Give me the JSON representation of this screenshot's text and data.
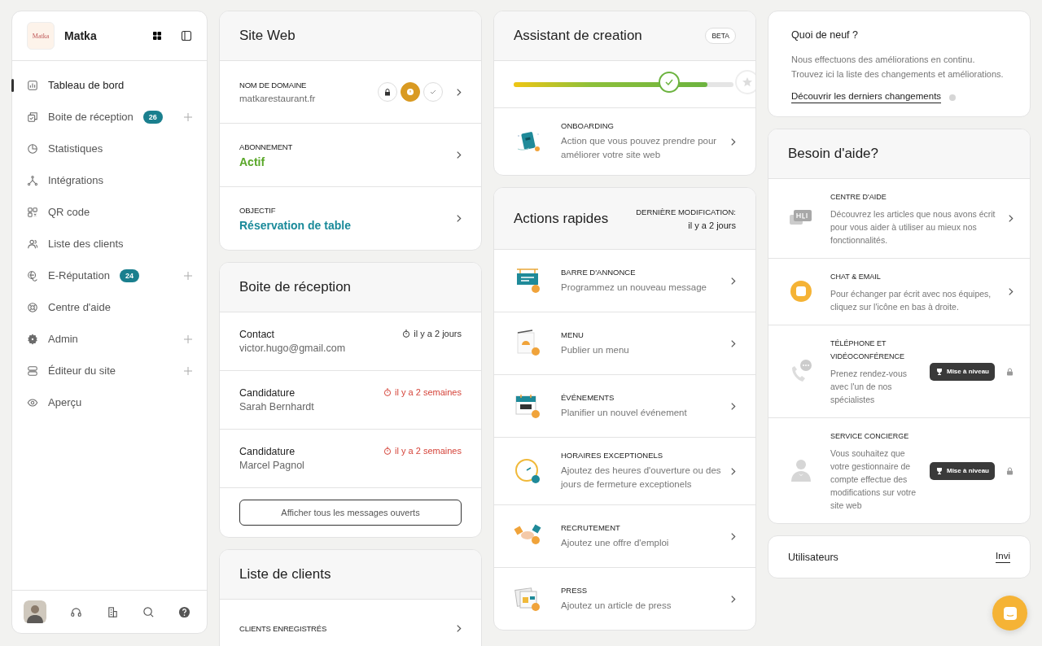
{
  "sidebar": {
    "brand": {
      "logo_text": "Matka",
      "name": "Matka"
    },
    "items": [
      {
        "kind": "dashboard",
        "label": "Tableau de bord",
        "selected": true,
        "expandable": false
      },
      {
        "kind": "inbox",
        "label": "Boite de réception",
        "badge": "26",
        "selected": false,
        "expandable": true
      },
      {
        "kind": "stats",
        "label": "Statistiques",
        "selected": false,
        "expandable": false
      },
      {
        "kind": "integrations",
        "label": "Intégrations",
        "selected": false,
        "expandable": false
      },
      {
        "kind": "qr",
        "label": "QR code",
        "selected": false,
        "expandable": false
      },
      {
        "kind": "clients",
        "label": "Liste des clients",
        "selected": false,
        "expandable": false
      },
      {
        "kind": "reputation",
        "label": "E-Réputation",
        "badge": "24",
        "selected": false,
        "expandable": true
      },
      {
        "kind": "help",
        "label": "Centre d'aide",
        "selected": false,
        "expandable": false
      },
      {
        "kind": "admin",
        "label": "Admin",
        "selected": false,
        "expandable": true
      },
      {
        "kind": "editor",
        "label": "Éditeur du site",
        "selected": false,
        "expandable": true
      },
      {
        "kind": "preview",
        "label": "Aperçu",
        "selected": false,
        "expandable": false
      }
    ]
  },
  "website": {
    "title": "Site Web",
    "rows": [
      {
        "label": "NOM DE DOMAINE",
        "value": "matkarestaurant.fr",
        "kind": "plain",
        "status": [
          {
            "kind": "lock",
            "selected": false
          },
          {
            "kind": "warning",
            "selected": true
          },
          {
            "kind": "check",
            "selected": false
          }
        ]
      },
      {
        "label": "ABONNEMENT",
        "value": "Actif",
        "kind": "success"
      },
      {
        "label": "OBJECTIF",
        "value": "Réservation de table",
        "kind": "link"
      }
    ]
  },
  "inbox": {
    "title": "Boite de réception",
    "messages": [
      {
        "type": "Contact",
        "from": "victor.hugo@gmail.com",
        "time": "il y a 2 jours",
        "overdue": false
      },
      {
        "type": "Candidature",
        "from": "Sarah Bernhardt",
        "time": "il y a 2 semaines",
        "overdue": true
      },
      {
        "type": "Candidature",
        "from": "Marcel Pagnol",
        "time": "il y a 2 semaines",
        "overdue": true
      }
    ],
    "button": "Afficher tous les messages ouverts"
  },
  "clients": {
    "title": "Liste de clients",
    "rows": [
      {
        "label": "CLIENTS ENREGISTRÉS"
      }
    ]
  },
  "assistant": {
    "title": "Assistant de creation",
    "badge": "BETA",
    "progress": {
      "level": 0.88
    },
    "item": {
      "kind": "onboarding",
      "title": "ONBOARDING",
      "text": "Action que vous pouvez prendre pour améliorer votre site web"
    }
  },
  "quick_actions": {
    "title": "Actions rapides",
    "meta_label": "DERNIÈRE MODIFICATION:",
    "meta_value": "il y a 2 jours",
    "items": [
      {
        "kind": "announcement",
        "title": "BARRE D'ANNONCE",
        "text": "Programmez un nouveau message"
      },
      {
        "kind": "menu",
        "title": "MENU",
        "text": "Publier un menu"
      },
      {
        "kind": "events",
        "title": "ÉVÉNEMENTS",
        "text": "Planifier un nouvel événement"
      },
      {
        "kind": "hours",
        "title": "HORAIRES EXCEPTIONELS",
        "text": "Ajoutez des heures d'ouverture ou des jours de fermeture exceptionels"
      },
      {
        "kind": "recruiting",
        "title": "RECRUTEMENT",
        "text": "Ajoutez une offre d'emploi"
      },
      {
        "kind": "press",
        "title": "PRESS",
        "text": "Ajoutez un article de press"
      }
    ]
  },
  "news": {
    "title": "Quoi de neuf ?",
    "lines": [
      "Nous effectuons des améliorations en continu.",
      "Trouvez ici la liste des changements et améliorations."
    ],
    "link": "Découvrir les derniers changements"
  },
  "help": {
    "title": "Besoin d'aide?",
    "items": [
      {
        "kind": "help",
        "title": "CENTRE D'AIDE",
        "text": "Découvrez les articles que nous avons écrit pour vous aider à utiliser au mieux nos fonctionnalités.",
        "locked": false
      },
      {
        "kind": "chat",
        "title": "CHAT & EMAIL",
        "text": "Pour échanger par écrit avec nos équipes, cliquez sur l'icône en bas à droite.",
        "locked": false
      },
      {
        "kind": "phone",
        "title": "TÉLÉPHONE ET VIDÉOCONFÉRENCE",
        "text": "Prenez rendez-vous avec l'un de nos spécialistes",
        "locked": true,
        "upgrade": "Mise à niveau"
      },
      {
        "kind": "concierge",
        "title": "SERVICE CONCIERGE",
        "text": "Vous souhaitez que votre gestionnaire de compte effectue des modifications sur votre site web",
        "locked": true,
        "upgrade": "Mise à niveau"
      }
    ]
  },
  "users": {
    "title": "Utilisateurs",
    "link": "Invi"
  }
}
